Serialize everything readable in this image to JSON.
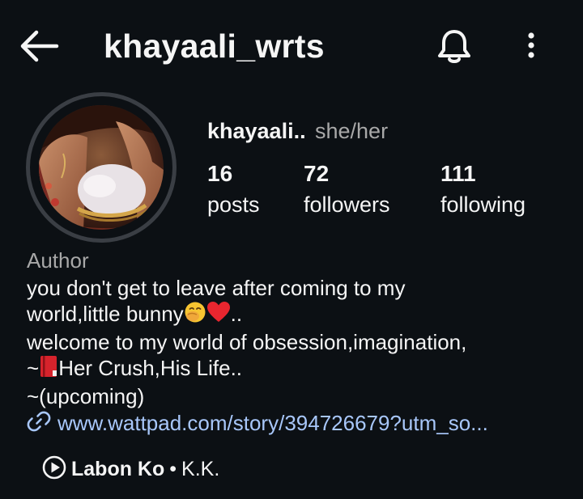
{
  "header": {
    "username": "khayaali_wrts"
  },
  "profile": {
    "display_name": "khayaali..",
    "pronouns": "she/her",
    "stats": {
      "posts": {
        "count": "16",
        "label": "posts"
      },
      "followers": {
        "count": "72",
        "label": "followers"
      },
      "following": {
        "count": "111",
        "label": "following"
      }
    },
    "category": "Author",
    "bio": {
      "line1": "you don't get to leave after coming to my",
      "line2_text": "world,little bunny",
      "line2_end": "..",
      "line3": "welcome to my world of obsession,imagination,",
      "line4_prefix": "~",
      "line4_text": "Her Crush,His Life..",
      "line5": "~(upcoming)"
    },
    "link": "www.wattpad.com/story/394726679?utm_so...",
    "music": {
      "title": "Labon Ko",
      "separator": "•",
      "artist": "K.K."
    }
  },
  "icons": {
    "back": "arrow-left-icon",
    "notifications": "bell-icon",
    "more": "more-vertical-icon",
    "link": "link-icon",
    "music": "play-circle-icon",
    "emoji1": "face-with-hand-over-mouth-emoji",
    "emoji2": "red-heart-emoji",
    "emoji3": "red-book-emoji"
  },
  "colors": {
    "background": "#0c1014",
    "text": "#f5f5f5",
    "secondary_text": "#a8a8a8",
    "link": "#a8c7fa",
    "avatar_ring": "#3a3e44"
  }
}
